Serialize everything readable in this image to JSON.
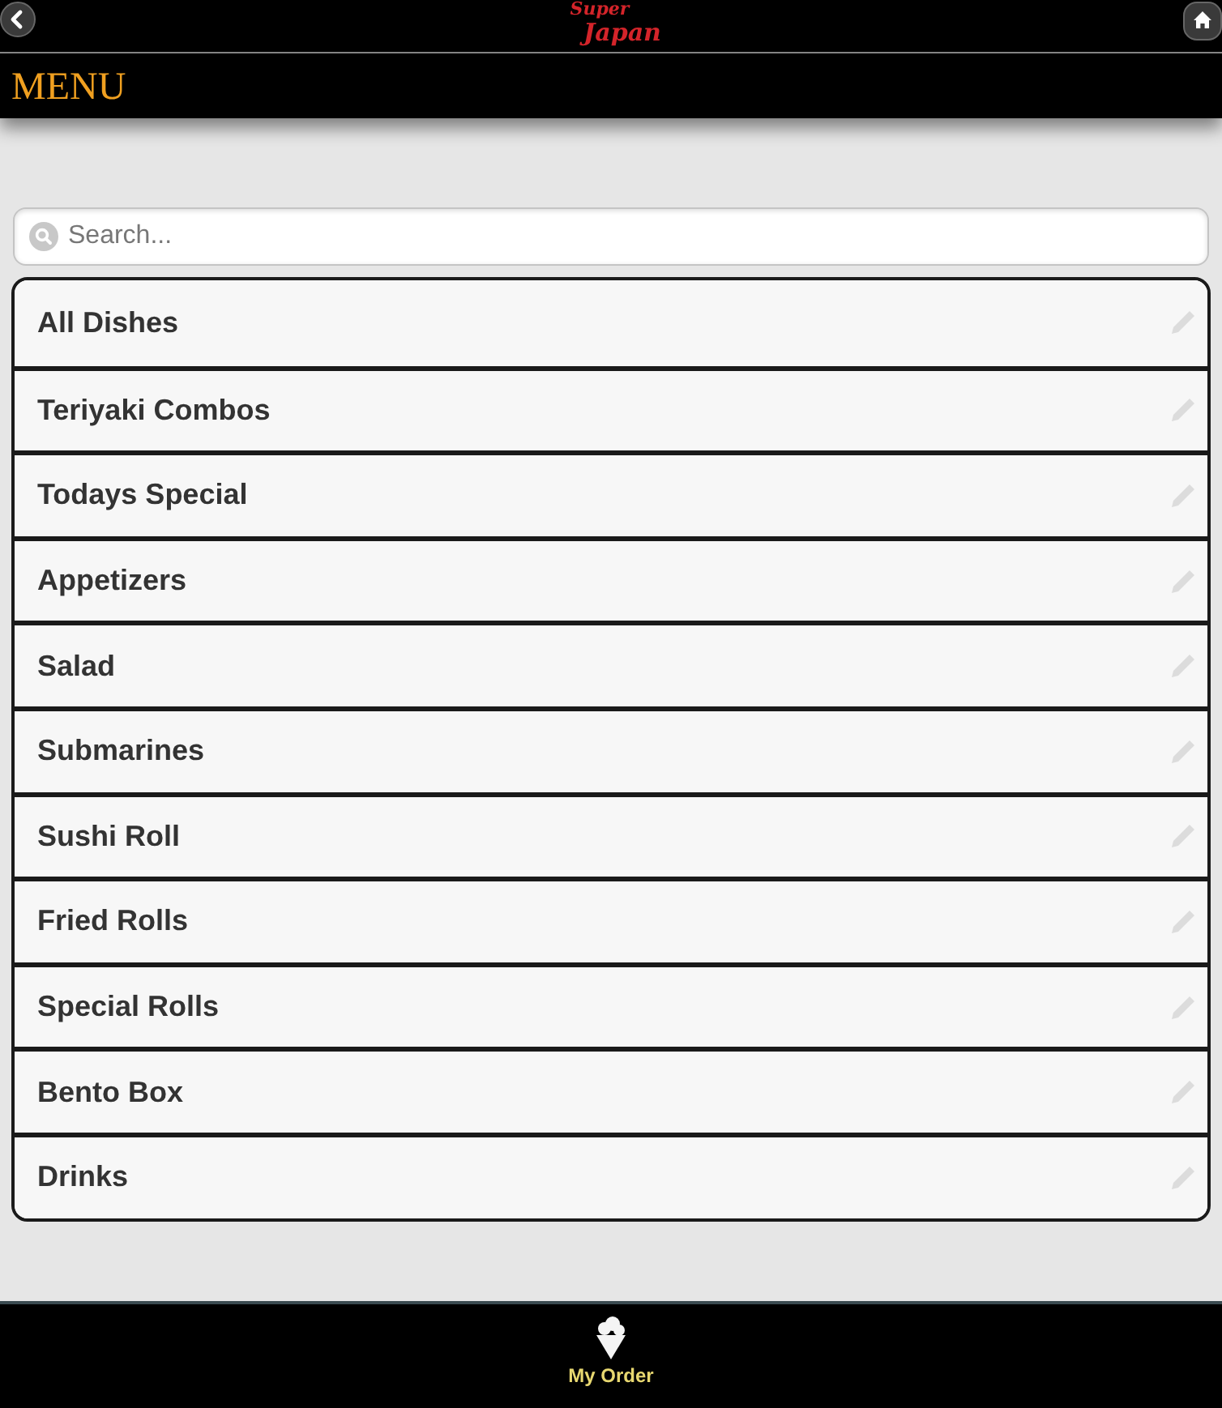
{
  "header": {
    "logo": {
      "line_1": "Super",
      "line_2": "Japan"
    }
  },
  "title_bar": {
    "title": "MENU"
  },
  "search": {
    "placeholder": "Search..."
  },
  "menu_items": [
    {
      "label": "All Dishes"
    },
    {
      "label": "Teriyaki Combos"
    },
    {
      "label": "Todays Special"
    },
    {
      "label": "Appetizers"
    },
    {
      "label": "Salad"
    },
    {
      "label": "Submarines"
    },
    {
      "label": "Sushi Roll"
    },
    {
      "label": "Fried Rolls"
    },
    {
      "label": "Special Rolls"
    },
    {
      "label": "Bento Box"
    },
    {
      "label": "Drinks"
    }
  ],
  "footer": {
    "tab": {
      "label": "My Order"
    }
  }
}
